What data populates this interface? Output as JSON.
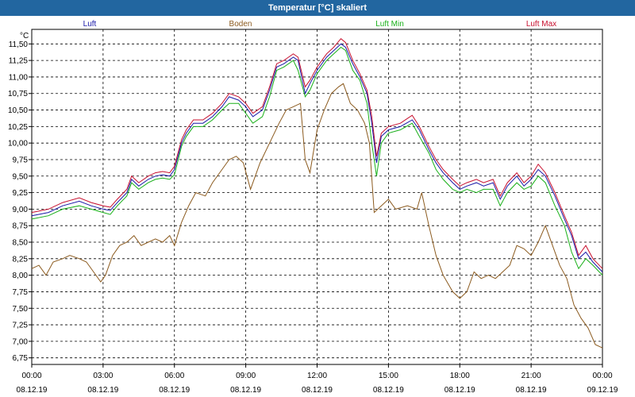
{
  "title": "Temperatur [°C] skaliert",
  "colors": {
    "Luft": "#1a1aa8",
    "Boden": "#8b5a1e",
    "Luft Min": "#19b019",
    "Luft Max": "#c8102e",
    "grid": "#000000"
  },
  "chart_data": {
    "type": "line",
    "title": "Temperatur [°C] skaliert",
    "ylabel": "°C",
    "xlabel": "",
    "ylim": [
      6.65,
      11.72
    ],
    "xlim": [
      0,
      24
    ],
    "grid": true,
    "legend": "top",
    "yticks": [
      "6,75",
      "7,00",
      "7,25",
      "7,50",
      "7,75",
      "8,00",
      "8,25",
      "8,50",
      "8,75",
      "9,00",
      "9,25",
      "9,50",
      "9,75",
      "10,00",
      "10,25",
      "10,50",
      "10,75",
      "11,00",
      "11,25",
      "11,50"
    ],
    "xticks": [
      {
        "time": "00:00",
        "date": "08.12.19"
      },
      {
        "time": "03:00",
        "date": "08.12.19"
      },
      {
        "time": "06:00",
        "date": "08.12.19"
      },
      {
        "time": "09:00",
        "date": "08.12.19"
      },
      {
        "time": "12:00",
        "date": "08.12.19"
      },
      {
        "time": "15:00",
        "date": "08.12.19"
      },
      {
        "time": "18:00",
        "date": "08.12.19"
      },
      {
        "time": "21:00",
        "date": "08.12.19"
      },
      {
        "time": "00:00",
        "date": "09.12.19"
      }
    ],
    "series": [
      {
        "name": "Luft",
        "color": "#1a1aa8",
        "points": [
          [
            0,
            8.9
          ],
          [
            0.7,
            8.95
          ],
          [
            1.3,
            9.05
          ],
          [
            2,
            9.12
          ],
          [
            2.5,
            9.05
          ],
          [
            3,
            9.0
          ],
          [
            3.3,
            8.98
          ],
          [
            3.6,
            9.1
          ],
          [
            4.0,
            9.25
          ],
          [
            4.2,
            9.45
          ],
          [
            4.5,
            9.35
          ],
          [
            4.9,
            9.45
          ],
          [
            5.2,
            9.5
          ],
          [
            5.5,
            9.52
          ],
          [
            5.8,
            9.5
          ],
          [
            6.0,
            9.6
          ],
          [
            6.3,
            10.0
          ],
          [
            6.5,
            10.15
          ],
          [
            6.8,
            10.3
          ],
          [
            7.2,
            10.3
          ],
          [
            7.6,
            10.4
          ],
          [
            8.0,
            10.55
          ],
          [
            8.3,
            10.7
          ],
          [
            8.7,
            10.65
          ],
          [
            9.0,
            10.55
          ],
          [
            9.3,
            10.4
          ],
          [
            9.7,
            10.5
          ],
          [
            10.0,
            10.8
          ],
          [
            10.3,
            11.15
          ],
          [
            10.6,
            11.2
          ],
          [
            11.0,
            11.3
          ],
          [
            11.2,
            11.25
          ],
          [
            11.5,
            10.75
          ],
          [
            11.7,
            10.9
          ],
          [
            12.0,
            11.1
          ],
          [
            12.4,
            11.3
          ],
          [
            12.7,
            11.4
          ],
          [
            13.0,
            11.5
          ],
          [
            13.2,
            11.45
          ],
          [
            13.5,
            11.2
          ],
          [
            13.8,
            11.0
          ],
          [
            14.1,
            10.75
          ],
          [
            14.3,
            10.3
          ],
          [
            14.5,
            9.7
          ],
          [
            14.7,
            10.1
          ],
          [
            15.0,
            10.2
          ],
          [
            15.5,
            10.25
          ],
          [
            16.0,
            10.35
          ],
          [
            16.3,
            10.2
          ],
          [
            16.7,
            9.9
          ],
          [
            17.0,
            9.7
          ],
          [
            17.3,
            9.55
          ],
          [
            17.7,
            9.4
          ],
          [
            18.0,
            9.3
          ],
          [
            18.3,
            9.35
          ],
          [
            18.7,
            9.4
          ],
          [
            19.0,
            9.35
          ],
          [
            19.4,
            9.4
          ],
          [
            19.7,
            9.15
          ],
          [
            20.0,
            9.35
          ],
          [
            20.4,
            9.5
          ],
          [
            20.7,
            9.35
          ],
          [
            21.0,
            9.45
          ],
          [
            21.3,
            9.6
          ],
          [
            21.6,
            9.5
          ],
          [
            22.0,
            9.2
          ],
          [
            22.4,
            8.85
          ],
          [
            22.7,
            8.6
          ],
          [
            23.0,
            8.25
          ],
          [
            23.3,
            8.35
          ],
          [
            23.6,
            8.2
          ],
          [
            24,
            8.05
          ]
        ]
      },
      {
        "name": "Boden",
        "color": "#8b5a1e",
        "points": [
          [
            0,
            8.1
          ],
          [
            0.3,
            8.15
          ],
          [
            0.6,
            8.0
          ],
          [
            0.9,
            8.2
          ],
          [
            1.3,
            8.25
          ],
          [
            1.6,
            8.3
          ],
          [
            2.0,
            8.25
          ],
          [
            2.3,
            8.2
          ],
          [
            2.6,
            8.05
          ],
          [
            2.9,
            7.9
          ],
          [
            3.1,
            8.0
          ],
          [
            3.4,
            8.3
          ],
          [
            3.7,
            8.45
          ],
          [
            4.0,
            8.5
          ],
          [
            4.3,
            8.6
          ],
          [
            4.6,
            8.45
          ],
          [
            4.9,
            8.5
          ],
          [
            5.2,
            8.55
          ],
          [
            5.5,
            8.5
          ],
          [
            5.8,
            8.6
          ],
          [
            6.0,
            8.45
          ],
          [
            6.3,
            8.8
          ],
          [
            6.6,
            9.05
          ],
          [
            6.9,
            9.25
          ],
          [
            7.3,
            9.2
          ],
          [
            7.6,
            9.4
          ],
          [
            8.0,
            9.6
          ],
          [
            8.3,
            9.75
          ],
          [
            8.6,
            9.8
          ],
          [
            8.9,
            9.7
          ],
          [
            9.2,
            9.3
          ],
          [
            9.6,
            9.7
          ],
          [
            10.0,
            10.0
          ],
          [
            10.4,
            10.3
          ],
          [
            10.7,
            10.5
          ],
          [
            11.0,
            10.55
          ],
          [
            11.3,
            10.6
          ],
          [
            11.5,
            9.75
          ],
          [
            11.7,
            9.55
          ],
          [
            12.0,
            10.2
          ],
          [
            12.3,
            10.5
          ],
          [
            12.6,
            10.75
          ],
          [
            12.9,
            10.85
          ],
          [
            13.1,
            10.9
          ],
          [
            13.4,
            10.6
          ],
          [
            13.7,
            10.5
          ],
          [
            14.0,
            10.3
          ],
          [
            14.2,
            10.0
          ],
          [
            14.4,
            8.95
          ],
          [
            14.7,
            9.05
          ],
          [
            15.0,
            9.15
          ],
          [
            15.3,
            9.0
          ],
          [
            15.8,
            9.05
          ],
          [
            16.2,
            9.0
          ],
          [
            16.4,
            9.25
          ],
          [
            16.7,
            8.75
          ],
          [
            17.0,
            8.3
          ],
          [
            17.3,
            8.0
          ],
          [
            17.7,
            7.75
          ],
          [
            18.0,
            7.65
          ],
          [
            18.3,
            7.75
          ],
          [
            18.6,
            8.05
          ],
          [
            18.9,
            7.95
          ],
          [
            19.2,
            8.0
          ],
          [
            19.5,
            7.95
          ],
          [
            19.8,
            8.05
          ],
          [
            20.1,
            8.15
          ],
          [
            20.4,
            8.45
          ],
          [
            20.7,
            8.4
          ],
          [
            21.0,
            8.3
          ],
          [
            21.3,
            8.5
          ],
          [
            21.6,
            8.75
          ],
          [
            21.9,
            8.45
          ],
          [
            22.2,
            8.15
          ],
          [
            22.5,
            7.95
          ],
          [
            22.8,
            7.55
          ],
          [
            23.1,
            7.35
          ],
          [
            23.4,
            7.2
          ],
          [
            23.7,
            6.95
          ],
          [
            24,
            6.9
          ]
        ]
      },
      {
        "name": "Luft Min",
        "color": "#19b019",
        "points": [
          [
            0,
            8.85
          ],
          [
            0.7,
            8.9
          ],
          [
            1.3,
            9.0
          ],
          [
            2,
            9.05
          ],
          [
            2.5,
            9.0
          ],
          [
            3,
            8.95
          ],
          [
            3.3,
            8.92
          ],
          [
            3.6,
            9.05
          ],
          [
            4.0,
            9.2
          ],
          [
            4.2,
            9.4
          ],
          [
            4.5,
            9.3
          ],
          [
            4.9,
            9.4
          ],
          [
            5.2,
            9.45
          ],
          [
            5.5,
            9.47
          ],
          [
            5.8,
            9.45
          ],
          [
            6.0,
            9.52
          ],
          [
            6.3,
            9.95
          ],
          [
            6.5,
            10.1
          ],
          [
            6.8,
            10.25
          ],
          [
            7.2,
            10.25
          ],
          [
            7.6,
            10.35
          ],
          [
            8.0,
            10.5
          ],
          [
            8.3,
            10.6
          ],
          [
            8.7,
            10.6
          ],
          [
            9.0,
            10.45
          ],
          [
            9.3,
            10.3
          ],
          [
            9.7,
            10.4
          ],
          [
            10.0,
            10.7
          ],
          [
            10.3,
            11.1
          ],
          [
            10.6,
            11.15
          ],
          [
            11.0,
            11.25
          ],
          [
            11.2,
            11.1
          ],
          [
            11.5,
            10.7
          ],
          [
            11.7,
            10.8
          ],
          [
            12.0,
            11.05
          ],
          [
            12.4,
            11.25
          ],
          [
            12.7,
            11.35
          ],
          [
            13.0,
            11.45
          ],
          [
            13.2,
            11.4
          ],
          [
            13.5,
            11.1
          ],
          [
            13.8,
            10.95
          ],
          [
            14.1,
            10.6
          ],
          [
            14.3,
            10.0
          ],
          [
            14.5,
            9.5
          ],
          [
            14.7,
            10.0
          ],
          [
            15.0,
            10.15
          ],
          [
            15.5,
            10.2
          ],
          [
            16.0,
            10.3
          ],
          [
            16.3,
            10.1
          ],
          [
            16.7,
            9.85
          ],
          [
            17.0,
            9.6
          ],
          [
            17.3,
            9.45
          ],
          [
            17.7,
            9.3
          ],
          [
            18.0,
            9.25
          ],
          [
            18.3,
            9.3
          ],
          [
            18.7,
            9.25
          ],
          [
            19.0,
            9.3
          ],
          [
            19.4,
            9.3
          ],
          [
            19.7,
            9.05
          ],
          [
            20.0,
            9.25
          ],
          [
            20.4,
            9.4
          ],
          [
            20.7,
            9.3
          ],
          [
            21.0,
            9.35
          ],
          [
            21.3,
            9.5
          ],
          [
            21.6,
            9.4
          ],
          [
            22.0,
            9.05
          ],
          [
            22.4,
            8.75
          ],
          [
            22.7,
            8.35
          ],
          [
            23.0,
            8.1
          ],
          [
            23.3,
            8.25
          ],
          [
            23.6,
            8.15
          ],
          [
            24,
            8.0
          ]
        ]
      },
      {
        "name": "Luft Max",
        "color": "#c8102e",
        "points": [
          [
            0,
            8.95
          ],
          [
            0.7,
            9.0
          ],
          [
            1.3,
            9.1
          ],
          [
            2,
            9.17
          ],
          [
            2.5,
            9.1
          ],
          [
            3,
            9.05
          ],
          [
            3.3,
            9.03
          ],
          [
            3.6,
            9.15
          ],
          [
            4.0,
            9.3
          ],
          [
            4.2,
            9.5
          ],
          [
            4.5,
            9.4
          ],
          [
            4.9,
            9.5
          ],
          [
            5.2,
            9.55
          ],
          [
            5.5,
            9.57
          ],
          [
            5.8,
            9.55
          ],
          [
            6.0,
            9.65
          ],
          [
            6.3,
            10.05
          ],
          [
            6.5,
            10.2
          ],
          [
            6.8,
            10.35
          ],
          [
            7.2,
            10.35
          ],
          [
            7.6,
            10.45
          ],
          [
            8.0,
            10.6
          ],
          [
            8.3,
            10.75
          ],
          [
            8.7,
            10.7
          ],
          [
            9.0,
            10.6
          ],
          [
            9.3,
            10.45
          ],
          [
            9.7,
            10.55
          ],
          [
            10.0,
            10.85
          ],
          [
            10.3,
            11.2
          ],
          [
            10.6,
            11.25
          ],
          [
            11.0,
            11.35
          ],
          [
            11.2,
            11.3
          ],
          [
            11.5,
            10.85
          ],
          [
            11.7,
            10.95
          ],
          [
            12.0,
            11.15
          ],
          [
            12.4,
            11.35
          ],
          [
            12.7,
            11.45
          ],
          [
            13.0,
            11.58
          ],
          [
            13.2,
            11.52
          ],
          [
            13.5,
            11.25
          ],
          [
            13.8,
            11.05
          ],
          [
            14.1,
            10.8
          ],
          [
            14.3,
            10.4
          ],
          [
            14.5,
            9.8
          ],
          [
            14.7,
            10.15
          ],
          [
            15.0,
            10.25
          ],
          [
            15.5,
            10.3
          ],
          [
            16.0,
            10.42
          ],
          [
            16.3,
            10.25
          ],
          [
            16.7,
            9.95
          ],
          [
            17.0,
            9.75
          ],
          [
            17.3,
            9.6
          ],
          [
            17.7,
            9.45
          ],
          [
            18.0,
            9.35
          ],
          [
            18.3,
            9.4
          ],
          [
            18.7,
            9.45
          ],
          [
            19.0,
            9.4
          ],
          [
            19.4,
            9.45
          ],
          [
            19.7,
            9.2
          ],
          [
            20.0,
            9.4
          ],
          [
            20.4,
            9.55
          ],
          [
            20.7,
            9.4
          ],
          [
            21.0,
            9.5
          ],
          [
            21.3,
            9.68
          ],
          [
            21.6,
            9.55
          ],
          [
            22.0,
            9.25
          ],
          [
            22.4,
            8.9
          ],
          [
            22.7,
            8.65
          ],
          [
            23.0,
            8.3
          ],
          [
            23.3,
            8.45
          ],
          [
            23.6,
            8.25
          ],
          [
            24,
            8.1
          ]
        ]
      }
    ]
  }
}
